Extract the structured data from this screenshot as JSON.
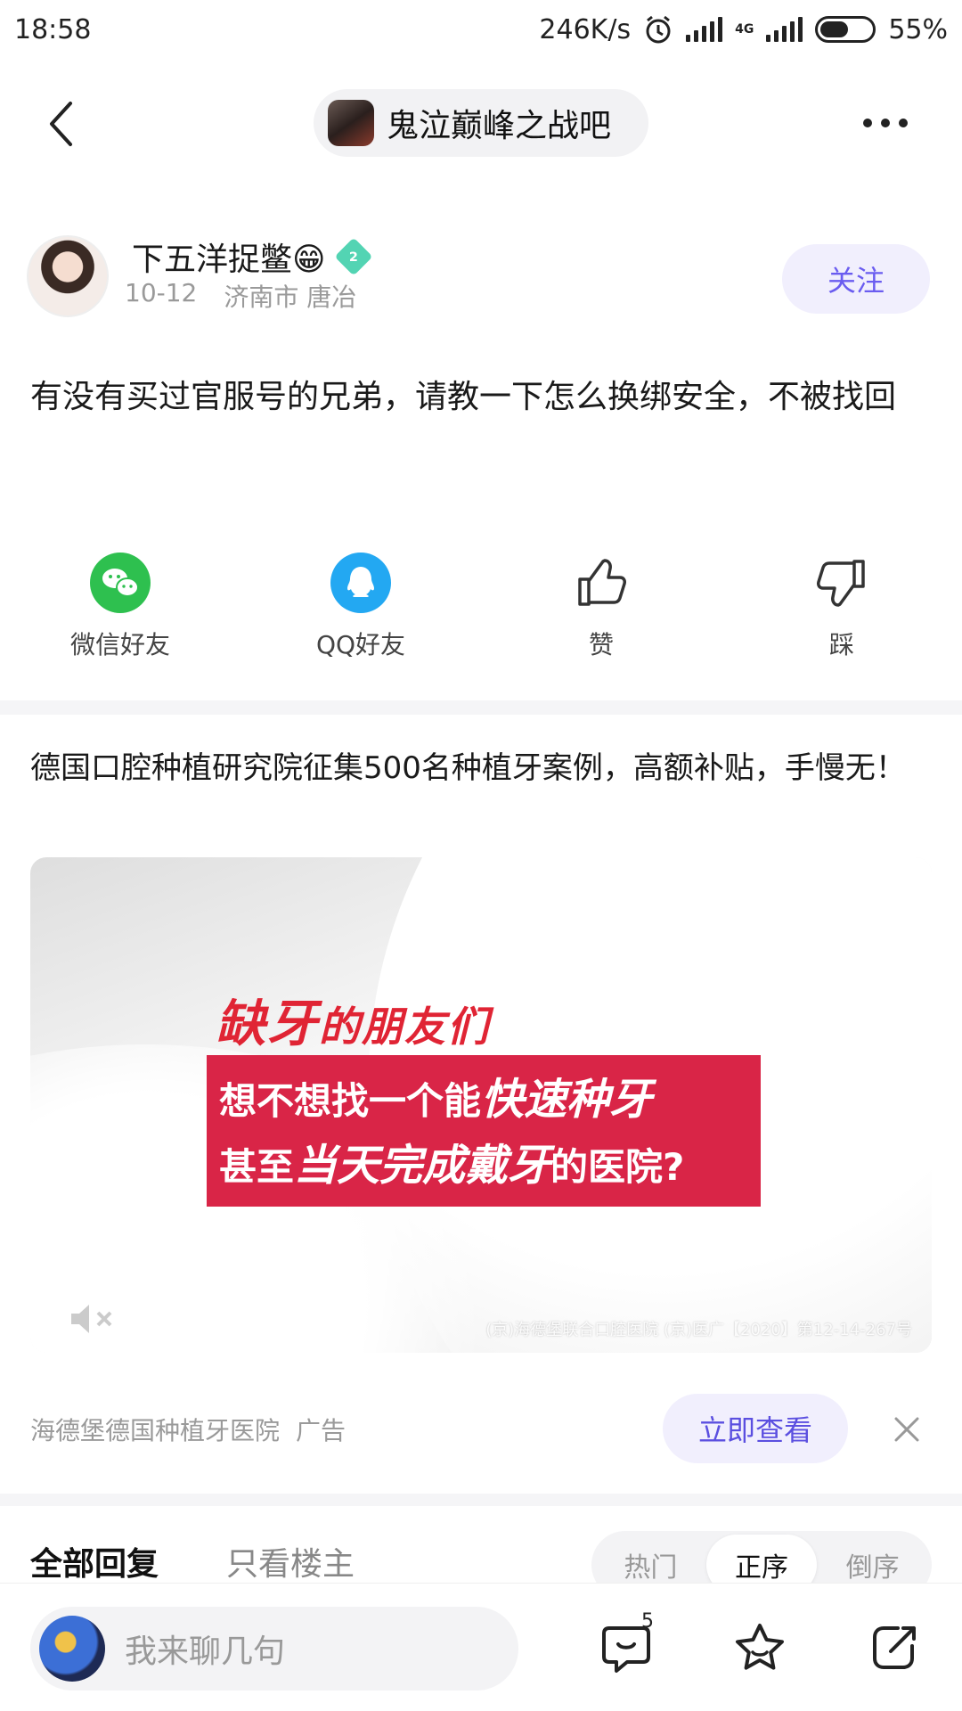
{
  "status_bar": {
    "time": "18:58",
    "speed": "246K/s",
    "network": "4G",
    "battery": "55%",
    "battery_level": 0.55
  },
  "nav": {
    "forum_name": "鬼泣巅峰之战吧"
  },
  "author": {
    "name": "下五洋捉鳖😁",
    "level": "2",
    "date": "10-12",
    "location": "济南市 唐冶",
    "follow_label": "关注"
  },
  "post": {
    "text": "有没有买过官服号的兄弟，请教一下怎么换绑安全，不被找回"
  },
  "share": [
    {
      "label": "微信好友"
    },
    {
      "label": "QQ好友"
    },
    {
      "label": "赞"
    },
    {
      "label": "踩"
    }
  ],
  "ad": {
    "title": "德国口腔种植研究院征集500名种植牙案例，高额补贴，手慢无！",
    "headline_big": "缺牙",
    "headline_small": "的朋友们",
    "box_line1_a": "想不想找一个能",
    "box_line1_b": "快速种牙",
    "box_line2_a": "甚至",
    "box_line2_b": "当天完成戴牙",
    "box_line2_c": "的医院?",
    "license": "(京)海德堡联合口腔医院 (京)医广【2020】第12-14-267号",
    "advertiser": "海德堡德国种植牙医院",
    "ad_label": "广告",
    "cta_label": "立即查看"
  },
  "replies": {
    "tab_all": "全部回复",
    "tab_op": "只看楼主",
    "sort_options": [
      "热门",
      "正序",
      "倒序"
    ],
    "active_sort": "正序"
  },
  "bottom_bar": {
    "placeholder": "我来聊几句",
    "comment_count": "5"
  }
}
